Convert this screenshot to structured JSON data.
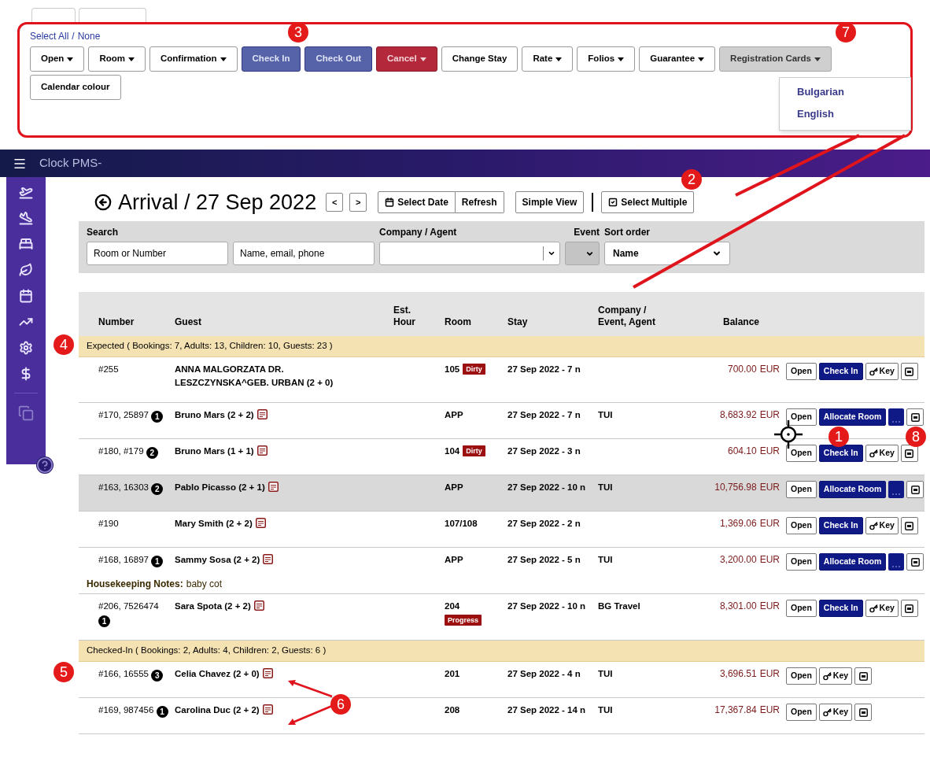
{
  "toolbar": {
    "select_all": "Select All",
    "separator": "/",
    "select_none": "None",
    "buttons": [
      {
        "label": "Open",
        "kind": "default",
        "caret": true
      },
      {
        "label": "Room",
        "kind": "default",
        "caret": true
      },
      {
        "label": "Confirmation",
        "kind": "default",
        "caret": true
      },
      {
        "label": "Check In",
        "kind": "primary",
        "caret": false
      },
      {
        "label": "Check Out",
        "kind": "primary",
        "caret": false
      },
      {
        "label": "Cancel",
        "kind": "danger",
        "caret": true
      },
      {
        "label": "Change Stay",
        "kind": "default",
        "caret": false
      },
      {
        "label": "Rate",
        "kind": "default",
        "caret": true
      },
      {
        "label": "Folios",
        "kind": "default",
        "caret": true
      },
      {
        "label": "Guarantee",
        "kind": "default",
        "caret": true
      },
      {
        "label": "Registration Cards",
        "kind": "muted",
        "caret": true
      },
      {
        "label": "Calendar colour",
        "kind": "default",
        "caret": false
      }
    ],
    "dropdown": [
      "Bulgarian",
      "English"
    ]
  },
  "app_title": "Clock PMS-",
  "page": {
    "title": "Arrival / 27 Sep 2022",
    "prev": "<",
    "next": ">",
    "select_date": "Select Date",
    "refresh": "Refresh",
    "simple_view": "Simple View",
    "select_multiple": "Select Multiple"
  },
  "filters": {
    "search_label": "Search",
    "room_placeholder": "Room or Number",
    "name_placeholder": "Name, email, phone",
    "company_label": "Company / Agent",
    "event_label": "Event",
    "sort_label": "Sort order",
    "sort_value": "Name"
  },
  "columns": [
    {
      "lines": [
        "Number"
      ]
    },
    {
      "lines": [
        "Guest"
      ]
    },
    {
      "lines": [
        "Est.",
        "Hour"
      ]
    },
    {
      "lines": [
        "Room"
      ]
    },
    {
      "lines": [
        "Stay"
      ]
    },
    {
      "lines": [
        "Company /",
        "Event, Agent"
      ]
    },
    {
      "lines": [
        "Balance"
      ]
    }
  ],
  "groups": [
    {
      "summary": "Expected ( Bookings: 7, Adults: 13, Children: 10, Guests: 23 )",
      "rows": [
        {
          "number": "#255",
          "guest": "ANNA MALGORZATA DR. LESZCZYNSKA^GEB. URBAN (2 + 0)",
          "note": false,
          "room": "105",
          "room_status": "Dirty",
          "stay": "27 Sep 2022 - 7 n",
          "amount": "700.00",
          "currency": "EUR",
          "selected": false,
          "actions": [
            {
              "kind": "open",
              "label": "Open"
            },
            {
              "kind": "checkin",
              "label": "Check In"
            },
            {
              "kind": "key",
              "label": "Key"
            },
            {
              "kind": "print"
            }
          ]
        },
        {
          "number": "#170, 25897",
          "count": "1",
          "guest": "Bruno Mars (2 + 2)",
          "note": true,
          "room": "APP",
          "stay": "27 Sep 2022 - 7 n",
          "company": "TUI",
          "amount": "8,683.92",
          "currency": "EUR",
          "selected": false,
          "actions": [
            {
              "kind": "open",
              "label": "Open"
            },
            {
              "kind": "allocate",
              "label": "Allocate Room"
            },
            {
              "kind": "more"
            },
            {
              "kind": "print"
            }
          ]
        },
        {
          "number": "#180, #179",
          "count": "2",
          "guest": "Bruno Mars (1 + 1)",
          "note": true,
          "room": "104",
          "room_status": "Dirty",
          "stay": "27 Sep 2022 - 3 n",
          "amount": "604.10",
          "currency": "EUR",
          "selected": false,
          "actions": [
            {
              "kind": "open",
              "label": "Open"
            },
            {
              "kind": "checkin",
              "label": "Check In"
            },
            {
              "kind": "key",
              "label": "Key"
            },
            {
              "kind": "print"
            }
          ]
        },
        {
          "number": "#163, 16303",
          "count": "2",
          "guest": "Pablo Picasso (2 + 1)",
          "note": true,
          "room": "APP",
          "stay": "27 Sep 2022 - 10 n",
          "company": "TUI",
          "amount": "10,756.98",
          "currency": "EUR",
          "selected": true,
          "actions": [
            {
              "kind": "open",
              "label": "Open"
            },
            {
              "kind": "allocate",
              "label": "Allocate Room"
            },
            {
              "kind": "more"
            },
            {
              "kind": "print"
            }
          ]
        },
        {
          "number": "#190",
          "guest": "Mary Smith (2 + 2)",
          "note": true,
          "room": "107/108",
          "stay": "27 Sep 2022 - 2 n",
          "amount": "1,369.06",
          "currency": "EUR",
          "selected": false,
          "actions": [
            {
              "kind": "open",
              "label": "Open"
            },
            {
              "kind": "checkin",
              "label": "Check In"
            },
            {
              "kind": "key",
              "label": "Key"
            },
            {
              "kind": "print"
            }
          ]
        },
        {
          "number": "#168, 16897",
          "count": "1",
          "guest": "Sammy Sosa (2 + 2)",
          "note": true,
          "room": "APP",
          "stay": "27 Sep 2022 - 5 n",
          "company": "TUI",
          "amount": "3,200.00",
          "currency": "EUR",
          "selected": false,
          "housekeeping": {
            "label": "Housekeeping Notes:",
            "text": "baby cot"
          },
          "actions": [
            {
              "kind": "open",
              "label": "Open"
            },
            {
              "kind": "allocate",
              "label": "Allocate Room"
            },
            {
              "kind": "more"
            },
            {
              "kind": "print"
            }
          ]
        },
        {
          "number": "#206, 7526474",
          "count": "1",
          "guest": "Sara Spota (2 + 2)",
          "note": true,
          "room": "204",
          "room_status": "Progress",
          "stay": "27 Sep 2022 - 10 n",
          "company": "BG Travel",
          "amount": "8,301.00",
          "currency": "EUR",
          "selected": false,
          "actions": [
            {
              "kind": "open",
              "label": "Open"
            },
            {
              "kind": "checkin",
              "label": "Check In"
            },
            {
              "kind": "key",
              "label": "Key"
            },
            {
              "kind": "print"
            }
          ]
        }
      ]
    },
    {
      "summary": "Checked-In ( Bookings: 2, Adults: 4, Children: 2, Guests: 6 )",
      "rows": [
        {
          "number": "#166, 16555",
          "count": "3",
          "guest": "Celia Chavez (2 + 0)",
          "note": true,
          "room": "201",
          "stay": "27 Sep 2022 - 4 n",
          "company": "TUI",
          "amount": "3,696.51",
          "currency": "EUR",
          "selected": false,
          "actions": [
            {
              "kind": "open",
              "label": "Open"
            },
            {
              "kind": "key",
              "label": "Key"
            },
            {
              "kind": "print"
            }
          ]
        },
        {
          "number": "#169, 987456",
          "count": "1",
          "guest": "Carolina Duc (2 + 2)",
          "note": true,
          "room": "208",
          "stay": "27 Sep 2022 - 14 n",
          "company": "TUI",
          "amount": "17,367.84",
          "currency": "EUR",
          "selected": false,
          "actions": [
            {
              "kind": "open",
              "label": "Open"
            },
            {
              "kind": "key",
              "label": "Key"
            },
            {
              "kind": "print"
            }
          ]
        }
      ]
    }
  ],
  "markers": [
    {
      "label": "3"
    },
    {
      "label": "7"
    },
    {
      "label": "2"
    },
    {
      "label": "4"
    },
    {
      "label": "5"
    },
    {
      "label": "1"
    },
    {
      "label": "8"
    },
    {
      "label": "6"
    }
  ]
}
